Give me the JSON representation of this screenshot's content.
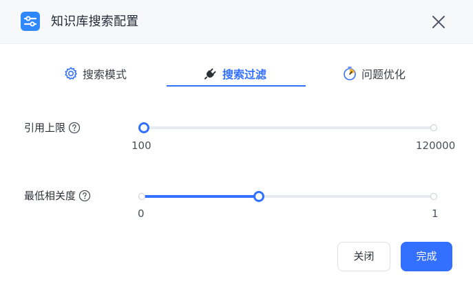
{
  "dialog": {
    "title": "知识库搜索配置",
    "close_icon": "close-icon",
    "app_icon": "sliders-icon"
  },
  "tabs": [
    {
      "label": "搜索模式",
      "icon": "gear-icon",
      "active": false
    },
    {
      "label": "搜索过滤",
      "icon": "plug-icon",
      "active": true
    },
    {
      "label": "问题优化",
      "icon": "timer-icon",
      "active": false
    }
  ],
  "settings": {
    "quote_limit": {
      "label": "引用上限",
      "help_icon": "question-icon",
      "min": "100",
      "max": "120000",
      "value": 100
    },
    "min_relevance": {
      "label": "最低相关度",
      "help_icon": "question-icon",
      "min": "0",
      "max": "1",
      "value": 0.4
    }
  },
  "footer": {
    "close_label": "关闭",
    "done_label": "完成"
  },
  "colors": {
    "accent": "#3370ff",
    "header_bg": "#f7f8fa",
    "track": "#e7eaef"
  }
}
